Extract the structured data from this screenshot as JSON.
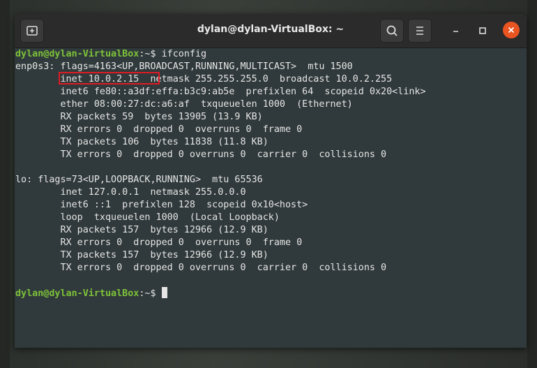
{
  "window": {
    "title": "dylan@dylan-VirtualBox: ~"
  },
  "terminal": {
    "prompt_user": "dylan@dylan-VirtualBox",
    "prompt_suffix": ":~$ ",
    "command": "ifconfig",
    "lines": [
      "enp0s3: flags=4163<UP,BROADCAST,RUNNING,MULTICAST>  mtu 1500",
      "        inet 10.0.2.15  netmask 255.255.255.0  broadcast 10.0.2.255",
      "        inet6 fe80::a3df:effa:b3c9:ab5e  prefixlen 64  scopeid 0x20<link>",
      "        ether 08:00:27:dc:a6:af  txqueuelen 1000  (Ethernet)",
      "        RX packets 59  bytes 13905 (13.9 KB)",
      "        RX errors 0  dropped 0  overruns 0  frame 0",
      "        TX packets 106  bytes 11838 (11.8 KB)",
      "        TX errors 0  dropped 0 overruns 0  carrier 0  collisions 0",
      "",
      "lo: flags=73<UP,LOOPBACK,RUNNING>  mtu 65536",
      "        inet 127.0.0.1  netmask 255.0.0.0",
      "        inet6 ::1  prefixlen 128  scopeid 0x10<host>",
      "        loop  txqueuelen 1000  (Local Loopback)",
      "        RX packets 157  bytes 12966 (12.9 KB)",
      "        RX errors 0  dropped 0  overruns 0  frame 0",
      "        TX packets 157  bytes 12966 (12.9 KB)",
      "        TX errors 0  dropped 0 overruns 0  carrier 0  collisions 0",
      ""
    ],
    "highlight_text": "inet 10.0.2.15"
  },
  "icons": {
    "new_tab": "new-tab-icon",
    "search": "search-icon",
    "menu": "hamburger-menu-icon",
    "minimize": "minimize-icon",
    "maximize": "maximize-icon",
    "close": "close-icon"
  },
  "colors": {
    "prompt": "#7ec23a",
    "close": "#e95420",
    "highlight": "#e01b24",
    "terminal_bg": "#30393b"
  }
}
